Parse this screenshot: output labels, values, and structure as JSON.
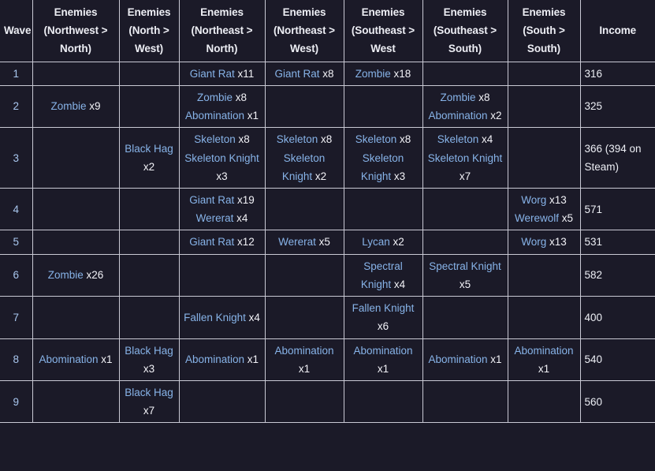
{
  "table": {
    "name": "wave-enemy-spawn-table",
    "colors": {
      "background": "#1b1a28",
      "border": "#c9c9d4",
      "link": "#87b3e8",
      "text": "#eceef4"
    },
    "headers": [
      "Wave",
      "Enemies (Northwest > North)",
      "Enemies (North > West)",
      "Enemies (Northeast > North)",
      "Enemies (Northeast > West)",
      "Enemies (Southeast > West",
      "Enemies (Southeast > South)",
      "Enemies (South > South)",
      "Income"
    ],
    "rows": [
      {
        "wave": "1",
        "lanes": [
          [],
          [],
          [
            {
              "enemy": "Giant Rat",
              "count": "x11"
            }
          ],
          [
            {
              "enemy": "Giant Rat",
              "count": "x8"
            }
          ],
          [
            {
              "enemy": "Zombie",
              "count": "x18"
            }
          ],
          [],
          []
        ],
        "income": "316"
      },
      {
        "wave": "2",
        "lanes": [
          [
            {
              "enemy": "Zombie",
              "count": "x9"
            }
          ],
          [],
          [
            {
              "enemy": "Zombie",
              "count": "x8"
            },
            {
              "enemy": "Abomination",
              "count": "x1"
            }
          ],
          [],
          [],
          [
            {
              "enemy": "Zombie",
              "count": "x8"
            },
            {
              "enemy": "Abomination",
              "count": "x2"
            }
          ],
          []
        ],
        "income": "325"
      },
      {
        "wave": "3",
        "lanes": [
          [],
          [
            {
              "enemy": "Black Hag",
              "count": "x2"
            }
          ],
          [
            {
              "enemy": "Skeleton",
              "count": "x8"
            },
            {
              "enemy": "Skeleton Knight",
              "count": "x3"
            }
          ],
          [
            {
              "enemy": "Skeleton",
              "count": "x8"
            },
            {
              "enemy": "Skeleton Knight",
              "count": "x2"
            }
          ],
          [
            {
              "enemy": "Skeleton",
              "count": "x8"
            },
            {
              "enemy": "Skeleton Knight",
              "count": "x3"
            }
          ],
          [
            {
              "enemy": "Skeleton",
              "count": "x4"
            },
            {
              "enemy": "Skeleton Knight",
              "count": "x7"
            }
          ],
          []
        ],
        "income": "366 (394 on Steam)"
      },
      {
        "wave": "4",
        "lanes": [
          [],
          [],
          [
            {
              "enemy": "Giant Rat",
              "count": "x19"
            },
            {
              "enemy": "Wererat",
              "count": "x4"
            }
          ],
          [],
          [],
          [],
          [
            {
              "enemy": "Worg",
              "count": "x13"
            },
            {
              "enemy": "Werewolf",
              "count": "x5"
            }
          ]
        ],
        "income": "571"
      },
      {
        "wave": "5",
        "lanes": [
          [],
          [],
          [
            {
              "enemy": "Giant Rat",
              "count": "x12"
            }
          ],
          [
            {
              "enemy": "Wererat",
              "count": "x5"
            }
          ],
          [
            {
              "enemy": "Lycan",
              "count": "x2"
            }
          ],
          [],
          [
            {
              "enemy": "Worg",
              "count": "x13"
            }
          ]
        ],
        "income": "531"
      },
      {
        "wave": "6",
        "lanes": [
          [
            {
              "enemy": "Zombie",
              "count": "x26"
            }
          ],
          [],
          [],
          [],
          [
            {
              "enemy": "Spectral Knight",
              "count": "x4"
            }
          ],
          [
            {
              "enemy": "Spectral Knight",
              "count": "x5"
            }
          ],
          []
        ],
        "income": "582"
      },
      {
        "wave": "7",
        "lanes": [
          [],
          [],
          [
            {
              "enemy": "Fallen Knight",
              "count": "x4"
            }
          ],
          [],
          [
            {
              "enemy": "Fallen Knight",
              "count": "x6"
            }
          ],
          [],
          []
        ],
        "income": "400"
      },
      {
        "wave": "8",
        "lanes": [
          [
            {
              "enemy": "Abomination",
              "count": "x1"
            }
          ],
          [
            {
              "enemy": "Black Hag",
              "count": "x3"
            }
          ],
          [
            {
              "enemy": "Abomination",
              "count": "x1"
            }
          ],
          [
            {
              "enemy": "Abomination",
              "count": "x1"
            }
          ],
          [
            {
              "enemy": "Abomination",
              "count": "x1"
            }
          ],
          [
            {
              "enemy": "Abomination",
              "count": "x1"
            }
          ],
          [
            {
              "enemy": "Abomination",
              "count": "x1"
            }
          ]
        ],
        "income": "540"
      },
      {
        "wave": "9",
        "lanes": [
          [],
          [
            {
              "enemy": "Black Hag",
              "count": "x7"
            }
          ],
          [],
          [],
          [],
          [],
          []
        ],
        "income": "560"
      }
    ]
  }
}
